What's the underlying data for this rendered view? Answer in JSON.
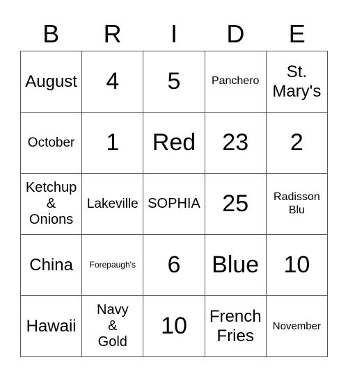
{
  "header": [
    "B",
    "R",
    "I",
    "D",
    "E"
  ],
  "cells": [
    [
      "August",
      "4",
      "5",
      "Panchero",
      "St.\nMary's"
    ],
    [
      "October",
      "1",
      "Red",
      "23",
      "2"
    ],
    [
      "Ketchup\n&\nOnions",
      "Lakeville",
      "SOPHIA",
      "25",
      "Radisson\nBlu"
    ],
    [
      "China",
      "Forepaugh's",
      "6",
      "Blue",
      "10"
    ],
    [
      "Hawaii",
      "Navy\n&\nGold",
      "10",
      "French\nFries",
      "November"
    ]
  ]
}
